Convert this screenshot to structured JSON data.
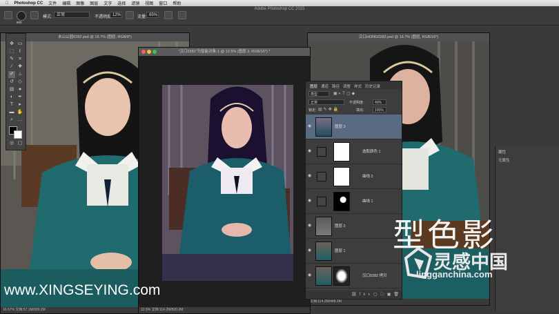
{
  "menubar": {
    "app": "Photoshop CC",
    "items": [
      "文件",
      "编辑",
      "图像",
      "图层",
      "文字",
      "选择",
      "滤镜",
      "视图",
      "窗口",
      "帮助"
    ]
  },
  "app_title": "Adobe Photoshop CC 2015",
  "options": {
    "brush_size": "800",
    "mode_label": "模式:",
    "mode_value": "正常",
    "opacity_label": "不透明度:",
    "opacity_value": "12%",
    "flow_label": "流量:",
    "flow_value": "65%"
  },
  "docs": {
    "left_title": "未山公园0282.psd @ 16.7% (图层, RGB/8*)",
    "left_status": "16.67%  文档:57.1M/309.2M",
    "center_title": "\"汉口0282\"为智能对象-1 @ 12.5% (图层 3, RGB/16*) *",
    "center_status": "12.5%   文档:114.2M/820.2M",
    "right_title": "汉口HONG0282.psd @ 16.7% (图层, RGB/16*)",
    "right_status": "文档:114.2M/448.2M"
  },
  "layers": {
    "tabs": [
      "图层",
      "通道",
      "路径",
      "调整",
      "样式",
      "历史记录"
    ],
    "kind_label": "类型",
    "blend_mode": "正常",
    "opacity_label": "不透明度:",
    "opacity_value": "40%",
    "lock_label": "锁定:",
    "fill_label": "填充:",
    "fill_value": "100%",
    "items": [
      {
        "name": "图层 3"
      },
      {
        "name": "选取颜色 1"
      },
      {
        "name": "曲线 2"
      },
      {
        "name": "曲线 1"
      },
      {
        "name": "图层 2"
      },
      {
        "name": "图层 1"
      },
      {
        "name": "汉口0282 拷贝"
      }
    ]
  },
  "props": {
    "title": "属性",
    "body": "无属性"
  },
  "watermark": {
    "url": "www.XINGSEYING.com",
    "brand": "型色影",
    "lg_cn": "灵感中国",
    "lg_site": "lingganchina.com"
  },
  "colors": {
    "dress": "#1f6b6e",
    "selected_layer": "#5a6a83",
    "panel": "#3d3d3d"
  }
}
